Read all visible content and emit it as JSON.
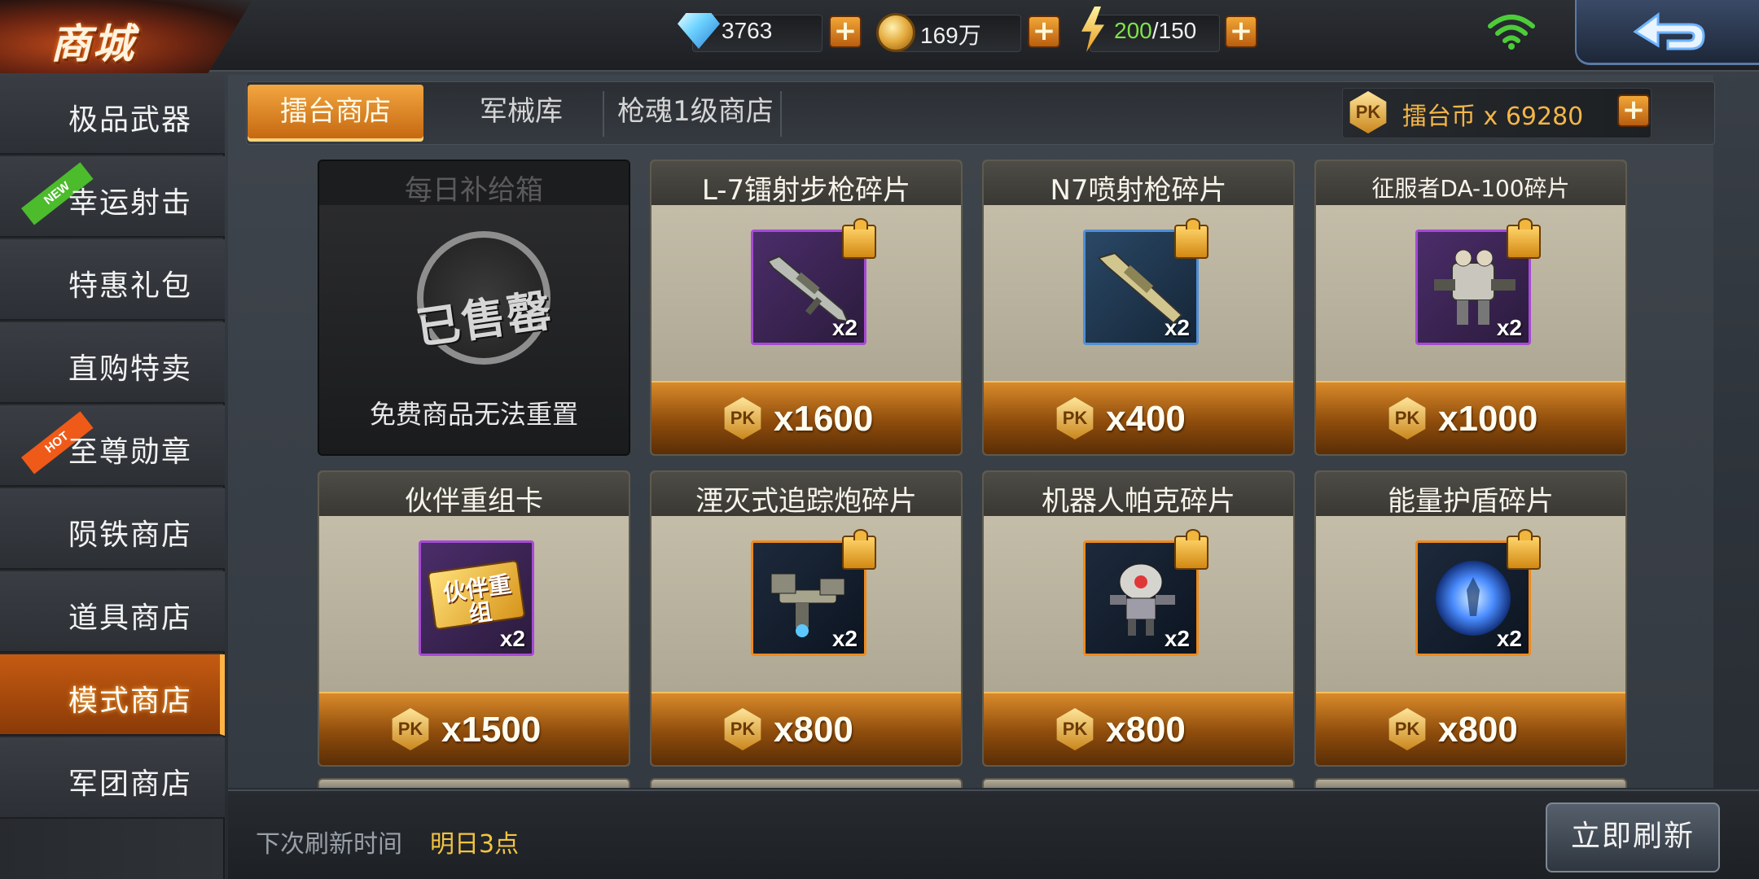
{
  "header": {
    "title": "商城",
    "resources": {
      "diamonds": "3763",
      "coins": "169万",
      "energy_current": "200",
      "energy_max": "/150"
    },
    "icons": {
      "diamond": "diamond-icon",
      "coin": "coin-icon",
      "energy": "lightning-icon",
      "wifi": "wifi-icon",
      "back": "back-arrow-icon"
    },
    "plus_label": "+"
  },
  "sidebar": {
    "items": [
      {
        "label": "极品武器",
        "badge": ""
      },
      {
        "label": "幸运射击",
        "badge": "NEW"
      },
      {
        "label": "特惠礼包",
        "badge": ""
      },
      {
        "label": "直购特卖",
        "badge": ""
      },
      {
        "label": "至尊勋章",
        "badge": "HOT"
      },
      {
        "label": "陨铁商店",
        "badge": ""
      },
      {
        "label": "道具商店",
        "badge": ""
      },
      {
        "label": "模式商店",
        "badge": "",
        "active": true
      },
      {
        "label": "军团商店",
        "badge": ""
      }
    ]
  },
  "tabs": [
    {
      "label": "擂台商店",
      "active": true
    },
    {
      "label": "军械库"
    },
    {
      "label": "枪魂1级商店"
    }
  ],
  "currency": {
    "icon_text": "PK",
    "label": "擂台币 x 69280",
    "plus_label": "+"
  },
  "cards": [
    {
      "title": "每日补给箱",
      "sold_out": true,
      "stamp": "已售罄",
      "note": "免费商品无法重置"
    },
    {
      "title": "L-7镭射步枪碎片",
      "qty": "x2",
      "price": "x1600",
      "frame": "purple",
      "fragment": true
    },
    {
      "title": "N7喷射枪碎片",
      "qty": "x2",
      "price": "x400",
      "frame": "blue",
      "fragment": true
    },
    {
      "title": "征服者DA-100碎片",
      "qty": "x2",
      "price": "x1000",
      "frame": "purple",
      "fragment": true
    },
    {
      "title": "伙伴重组卡",
      "qty": "x2",
      "price": "x1500",
      "frame": "purple",
      "fragment": false,
      "card_text": "伙伴重组"
    },
    {
      "title": "湮灭式追踪炮碎片",
      "qty": "x2",
      "price": "x800",
      "frame": "orange",
      "fragment": true
    },
    {
      "title": "机器人帕克碎片",
      "qty": "x2",
      "price": "x800",
      "frame": "orange",
      "fragment": true
    },
    {
      "title": "能量护盾碎片",
      "qty": "x2",
      "price": "x800",
      "frame": "orange",
      "fragment": true
    }
  ],
  "footer": {
    "refresh_label": "下次刷新时间",
    "refresh_time": "明日3点",
    "refresh_button": "立即刷新"
  },
  "colors": {
    "accent_orange": "#e58a22",
    "energy_green": "#7ee34a",
    "gold_text": "#f4b647",
    "new_badge": "#4cbb2c",
    "hot_badge": "#f05a18"
  }
}
